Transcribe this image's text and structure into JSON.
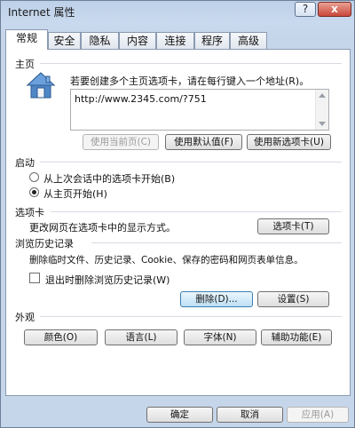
{
  "window": {
    "title": "Internet 属性",
    "help_label": "?",
    "close_label": "x"
  },
  "tabs": [
    {
      "label": "常规",
      "active": true
    },
    {
      "label": "安全"
    },
    {
      "label": "隐私"
    },
    {
      "label": "内容"
    },
    {
      "label": "连接"
    },
    {
      "label": "程序"
    },
    {
      "label": "高级"
    }
  ],
  "home": {
    "heading": "主页",
    "description": "若要创建多个主页选项卡，请在每行键入一个地址(R)。",
    "url": "http://www.2345.com/?751",
    "buttons": {
      "use_current": "使用当前页(C)",
      "use_default": "使用默认值(F)",
      "use_new_tab": "使用新选项卡(U)"
    }
  },
  "startup": {
    "heading": "启动",
    "option_last_session": "从上次会话中的选项卡开始(B)",
    "option_home": "从主页开始(H)"
  },
  "tabs_section": {
    "heading": "选项卡",
    "description": "更改网页在选项卡中的显示方式。",
    "button": "选项卡(T)"
  },
  "history": {
    "heading": "浏览历史记录",
    "description": "删除临时文件、历史记录、Cookie、保存的密码和网页表单信息。",
    "checkbox_label": "退出时删除浏览历史记录(W)",
    "delete_button": "删除(D)...",
    "settings_button": "设置(S)"
  },
  "appearance": {
    "heading": "外观",
    "colors_button": "颜色(O)",
    "languages_button": "语言(L)",
    "fonts_button": "字体(N)",
    "accessibility_button": "辅助功能(E)"
  },
  "footer": {
    "ok_button": "确定",
    "cancel_button": "取消",
    "apply_button": "应用(A)"
  }
}
